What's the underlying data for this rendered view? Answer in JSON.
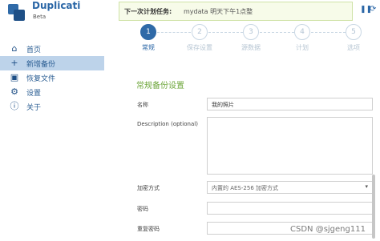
{
  "app": {
    "title": "Duplicati",
    "beta": "Beta"
  },
  "header": {
    "schedule_label": "下一次计划任务:",
    "schedule_value": "mydata 明天下午1点整",
    "pause_icon": "pause-icon",
    "refresh_icon": "refresh-icon"
  },
  "sidebar": {
    "items": [
      {
        "label": "首页",
        "icon": "home-icon",
        "glyph": "⌂"
      },
      {
        "label": "新增备份",
        "icon": "plus-icon",
        "glyph": "+"
      },
      {
        "label": "恢复文件",
        "icon": "restore-icon",
        "glyph": "▣"
      },
      {
        "label": "设置",
        "icon": "gear-icon",
        "glyph": "⚙"
      },
      {
        "label": "关于",
        "icon": "info-icon",
        "glyph": "ⓘ"
      }
    ]
  },
  "wizard": {
    "steps": [
      {
        "num": "1",
        "label": "常规"
      },
      {
        "num": "2",
        "label": "保存设置"
      },
      {
        "num": "3",
        "label": "源数据"
      },
      {
        "num": "4",
        "label": "计划"
      },
      {
        "num": "5",
        "label": "选项"
      }
    ]
  },
  "form": {
    "section_title": "常规备份设置",
    "name_label": "名称",
    "name_value": "我的照片",
    "description_label": "Description (optional)",
    "encryption_label": "加密方式",
    "encryption_value": "内置的 AES-256 加密方式",
    "password_label": "密码",
    "repeat_password_label": "重复密码"
  },
  "watermark": "CSDN @sjgeng111",
  "colors": {
    "accent": "#2f6aa8",
    "section_green": "#6da63a",
    "active_nav": "#bdd3ea"
  }
}
